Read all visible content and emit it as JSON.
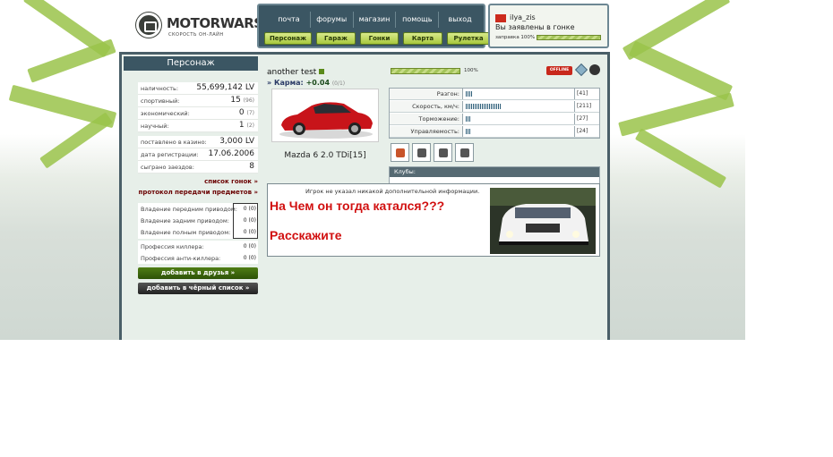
{
  "logo": {
    "title": "MOTORWARS.RU",
    "subtitle": "СКОРОСТЬ ОН-ЛАЙН"
  },
  "nav": {
    "links": [
      "почта",
      "форумы",
      "магазин",
      "помощь",
      "выход"
    ],
    "buttons": [
      "Персонаж",
      "Гараж",
      "Гонки",
      "Карта",
      "Рулетка"
    ]
  },
  "user": {
    "name": "ilya_zis",
    "status": "Вы заявлены в гонке",
    "fuel_label": "заправка 100%",
    "fuel_fraction": 1.0
  },
  "character": {
    "title": "Персонаж",
    "stats1": [
      {
        "label": "наличность:",
        "value": "55,699,142 LV",
        "small": ""
      },
      {
        "label": "спортивный:",
        "value": "15",
        "small": "(96)"
      },
      {
        "label": "экономический:",
        "value": "0",
        "small": "(7)"
      },
      {
        "label": "научный:",
        "value": "1",
        "small": "(2)"
      }
    ],
    "stats2": [
      {
        "label": "поставлено в казино:",
        "value": "3,000 LV"
      },
      {
        "label": "дата регистрации:",
        "value": "17.06.2006"
      },
      {
        "label": "сыграно заездов:",
        "value": "8"
      }
    ],
    "race_list_link": "список гонок »",
    "transfer_log_link": "протокол передачи предметов »",
    "ownership": [
      {
        "label": "Владение передним приводом:",
        "value": "0",
        "small": "(0)"
      },
      {
        "label": "Владение задним приводом:",
        "value": "0",
        "small": "(0)"
      },
      {
        "label": "Владение полным приводом:",
        "value": "0",
        "small": "(0)"
      }
    ],
    "professions": [
      {
        "label": "Профессия киллера:",
        "value": "0",
        "small": "(0)"
      },
      {
        "label": "Профессия анти-киллера:",
        "value": "0",
        "small": "(0)"
      }
    ],
    "add_friend": "добавить в друзья »",
    "add_blacklist": "добавить в чёрный список »"
  },
  "profile": {
    "username": "another test",
    "karma_label": "» Карма:",
    "karma_value": "+0.04",
    "karma_small": "(0/1)",
    "car_name": "Mazda 6 2.0 TDi[15]",
    "progress_label": "100%",
    "progress_fraction": 1.0,
    "offline_badge": "OFFLINE"
  },
  "car_stats": [
    {
      "label": "Разгон:",
      "value": "[41]",
      "level": 41
    },
    {
      "label": "Скорость, км/ч:",
      "value": "[211]",
      "level": 211
    },
    {
      "label": "Торможение:",
      "value": "[27]",
      "level": 27
    },
    {
      "label": "Управляемость:",
      "value": "[24]",
      "level": 24
    }
  ],
  "clubs": {
    "header": "Клубы:"
  },
  "info": {
    "no_info": "Игрок не указал никакой дополнительной информации.",
    "line1": "На Чем он тогда катался???",
    "line2": "Расскажите"
  },
  "colors": {
    "nav_bg": "#3b5663",
    "accent_green": "#a8c83d",
    "red_text": "#d11010"
  }
}
